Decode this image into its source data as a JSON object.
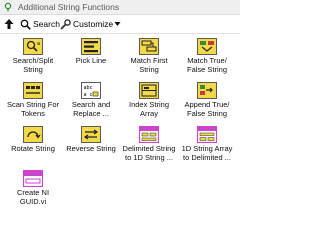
{
  "window": {
    "title": "Additional String Functions"
  },
  "toolbar": {
    "search_label": "Search",
    "customize_label": "Customize"
  },
  "palette": {
    "items": [
      {
        "label": "Search/Split\nString",
        "icon": "search-split-string-icon"
      },
      {
        "label": "Pick Line",
        "icon": "pick-line-icon"
      },
      {
        "label": "Match First\nString",
        "icon": "match-first-string-icon"
      },
      {
        "label": "Match True/\nFalse String",
        "icon": "match-true-false-string-icon"
      },
      {
        "label": "Scan String For\nTokens",
        "icon": "scan-string-for-tokens-icon"
      },
      {
        "label": "Search and\nReplace ...",
        "icon": "search-and-replace-icon"
      },
      {
        "label": "Index String\nArray",
        "icon": "index-string-array-icon"
      },
      {
        "label": "Append True/\nFalse String",
        "icon": "append-true-false-string-icon"
      },
      {
        "label": "Rotate String",
        "icon": "rotate-string-icon"
      },
      {
        "label": "Reverse String",
        "icon": "reverse-string-icon"
      },
      {
        "label": "Delimited String\nto 1D String ...",
        "icon": "delimited-string-to-1d-array-icon"
      },
      {
        "label": "1D String Array\nto Delimited ...",
        "icon": "1d-string-array-to-delimited-icon"
      },
      {
        "label": "Create NI\nGUID.vi",
        "icon": "create-ni-guid-icon"
      }
    ]
  },
  "colors": {
    "icon_yellow": "#f2d94a",
    "icon_purple": "#cc44cc",
    "icon_border": "#5a5a5a"
  }
}
